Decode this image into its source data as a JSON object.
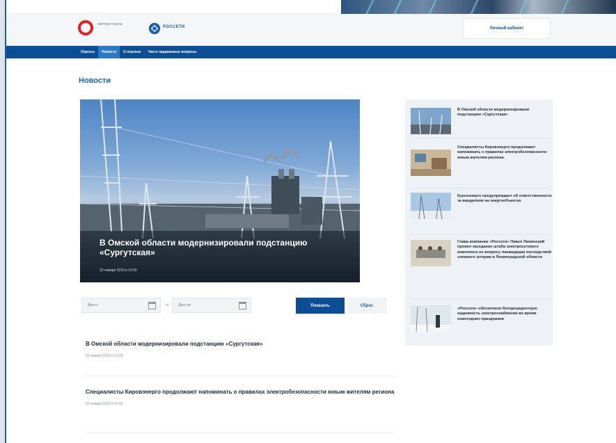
{
  "header": {
    "logo_text": "светлая страна",
    "brand": "РОССЕТИ",
    "cabinet_button": "Личный кабинет"
  },
  "nav": [
    {
      "label": "Опросы",
      "active": false
    },
    {
      "label": "Новости",
      "active": true
    },
    {
      "label": "О портале",
      "active": false
    },
    {
      "label": "Часто задаваемые вопросы",
      "active": false
    }
  ],
  "page_title": "Новости",
  "hero": {
    "title": "В Омской области модернизировали подстанцию «Сургутская»",
    "date": "23 января 2019 в 10:00"
  },
  "filter": {
    "date_from_placeholder": "Дата с",
    "separator": "–",
    "date_to_placeholder": "Дата по",
    "show_button": "Показать",
    "reset_button": "Сброс"
  },
  "news": [
    {
      "title": "В Омской области модернизировали подстанцию «Сургутская»",
      "date": "23 января 2019 в 10:00"
    },
    {
      "title": "Специалисты Кировэнерго продолжают напоминать о правилах электробезопасности юным жителям региона",
      "date": "23 января 2019 в 10:00"
    }
  ],
  "sidebar": [
    {
      "text": "В Омской области модернизировали подстанцию «Сургутская»"
    },
    {
      "text": "Специалисты Кировэнерго продолжают напоминать о правилах электробезопасности юным жителям региона"
    },
    {
      "text": "Курскэнерго предупреждает об ответственности за вандализм на энергообъектах"
    },
    {
      "text": "Глава компании «Россети» Павел Ливинский провел заседание штаба электросетевого комплекса по вопросу ликвидации последствий снежного шторма в Ленинградской области"
    },
    {
      "text": "«Россети» обеспечили беспрецедентную надежность электроснабжения во время новогодних праздников"
    }
  ],
  "colors": {
    "brand_blue": "#0d4d94",
    "nav_active": "#2d77c9",
    "logo_red": "#e31e24"
  }
}
